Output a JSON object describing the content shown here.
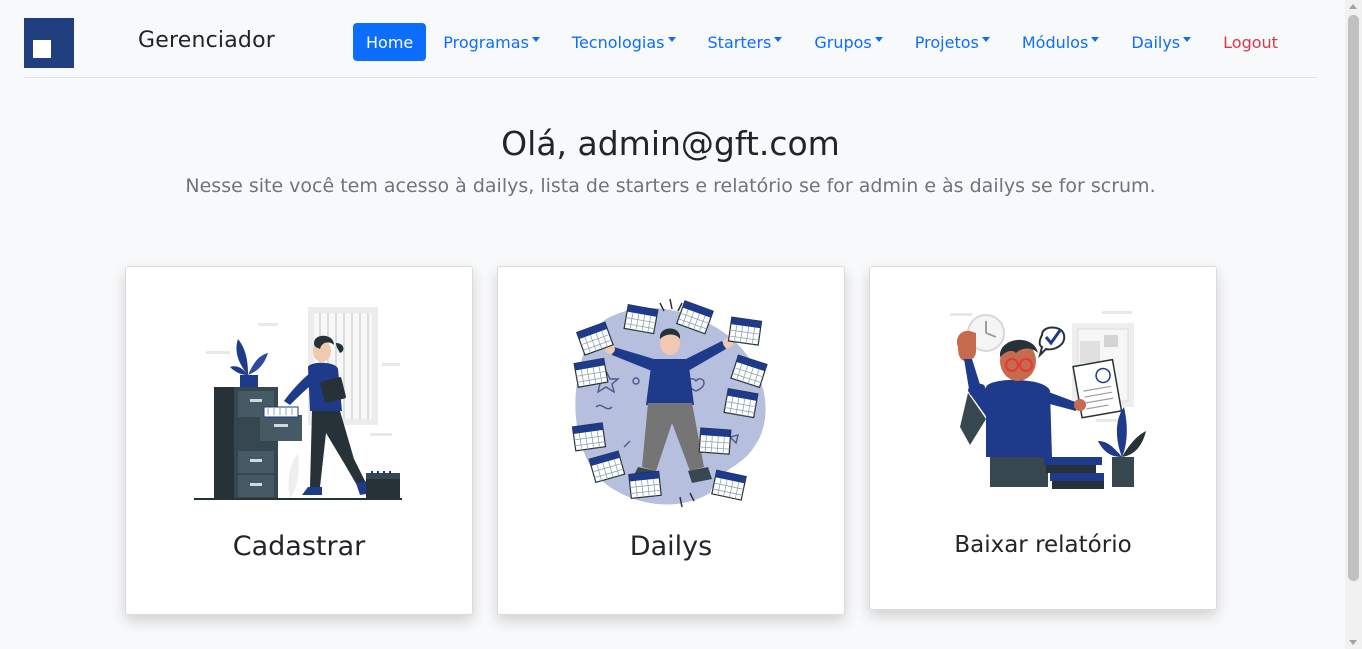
{
  "app": {
    "brand": "Gerenciador"
  },
  "nav": {
    "items": [
      {
        "label": "Home",
        "active": true,
        "dropdown": false
      },
      {
        "label": "Programas",
        "active": false,
        "dropdown": true
      },
      {
        "label": "Tecnologias",
        "active": false,
        "dropdown": true
      },
      {
        "label": "Starters",
        "active": false,
        "dropdown": true
      },
      {
        "label": "Grupos",
        "active": false,
        "dropdown": true
      },
      {
        "label": "Projetos",
        "active": false,
        "dropdown": true
      },
      {
        "label": "Módulos",
        "active": false,
        "dropdown": true
      },
      {
        "label": "Dailys",
        "active": false,
        "dropdown": true
      }
    ],
    "logout": "Logout"
  },
  "hero": {
    "title": "Olá, admin@gft.com",
    "subtitle": "Nesse site você tem acesso à dailys, lista de starters e relatório se for admin e às dailys se for scrum."
  },
  "cards": [
    {
      "title": "Cadastrar",
      "icon": "filing-cabinet-illustration"
    },
    {
      "title": "Dailys",
      "icon": "calendars-illustration"
    },
    {
      "title": "Baixar relatório",
      "icon": "report-illustration"
    }
  ],
  "colors": {
    "primary": "#0d6efd",
    "danger": "#dc3545",
    "brand_navy": "#213f7f",
    "illustration_navy": "#1e3a8a"
  }
}
